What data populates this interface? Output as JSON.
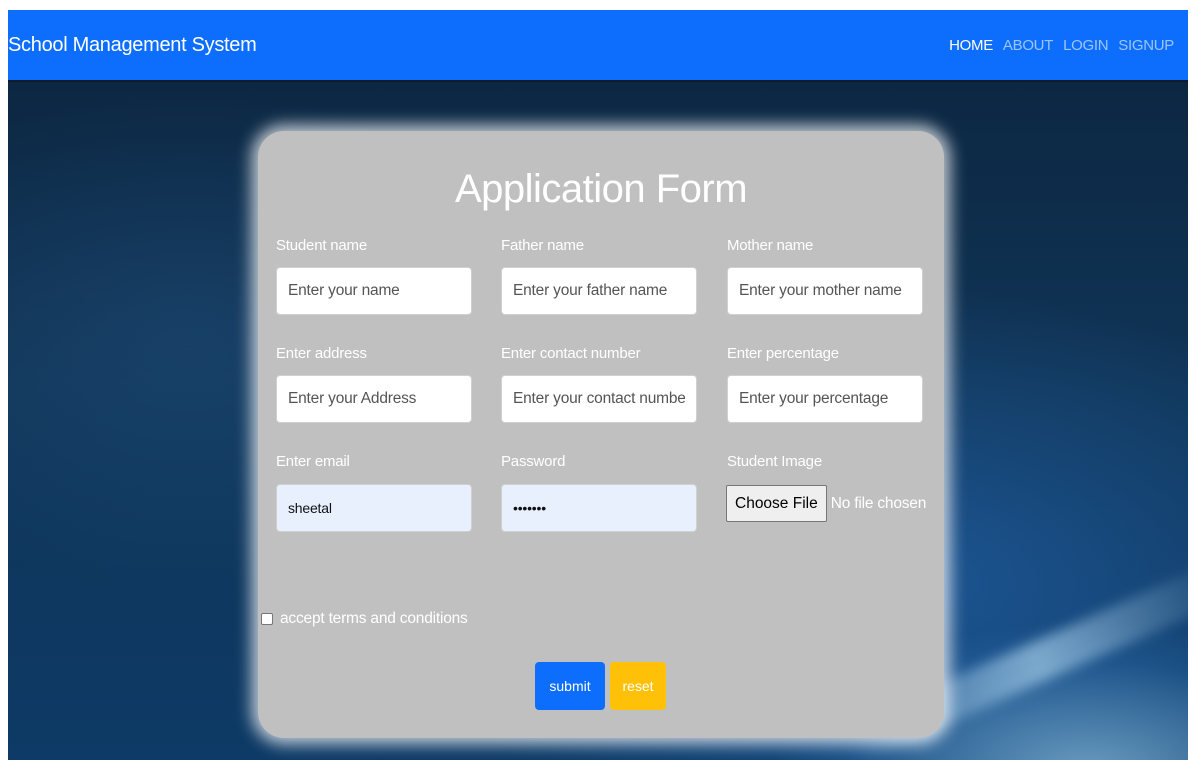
{
  "navbar": {
    "brand": "School Management System",
    "links": [
      "HOME",
      "ABOUT",
      "LOGIN",
      "SIGNUP"
    ],
    "active_link": "HOME"
  },
  "form": {
    "title": "Application Form",
    "fields": [
      {
        "label": "Student name",
        "placeholder": "Enter your name",
        "value": ""
      },
      {
        "label": "Father name",
        "placeholder": "Enter your father name",
        "value": ""
      },
      {
        "label": "Mother name",
        "placeholder": "Enter your mother name",
        "value": ""
      },
      {
        "label": "Enter address",
        "placeholder": "Enter your Address",
        "value": ""
      },
      {
        "label": "Enter contact number",
        "placeholder": "Enter your contact number",
        "value": ""
      },
      {
        "label": "Enter percentage",
        "placeholder": "Enter your percentage",
        "value": ""
      },
      {
        "label": "Enter email",
        "placeholder": "",
        "value": "sheetal"
      },
      {
        "label": "Password",
        "placeholder": "",
        "value": "•••••••"
      },
      {
        "label": "Student Image"
      }
    ],
    "file_input": {
      "button_label": "Choose File",
      "status": "No file chosen"
    },
    "terms_label": "accept terms and conditions",
    "submit_label": "submit",
    "reset_label": "reset"
  },
  "colors": {
    "navbar": "#0d6efd",
    "card": "#c0c0c0",
    "submit": "#0d6efd",
    "reset": "#ffc107",
    "autofill": "#e8f0fe"
  }
}
